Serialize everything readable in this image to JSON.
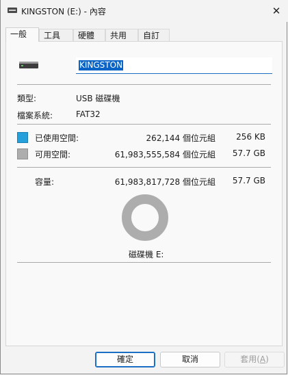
{
  "window": {
    "title": "KINGSTON (E:) - 內容",
    "close_glyph": "✕"
  },
  "tabs": [
    {
      "label": "一般",
      "active": true
    },
    {
      "label": "工具",
      "active": false
    },
    {
      "label": "硬體",
      "active": false
    },
    {
      "label": "共用",
      "active": false
    },
    {
      "label": "自訂",
      "active": false
    }
  ],
  "general": {
    "drive_icon": "usb-drive-icon",
    "volume_name": "KINGSTON",
    "type_label": "類型:",
    "type_value": "USB 磁碟機",
    "fs_label": "檔案系統:",
    "fs_value": "FAT32",
    "used": {
      "label": "已使用空間:",
      "bytes": "262,144 個位元組",
      "size": "256 KB",
      "color": "#26a0da"
    },
    "free": {
      "label": "可用空間:",
      "bytes": "61,983,555,584 個位元組",
      "size": "57.7 GB",
      "color": "#adadad"
    },
    "capacity": {
      "label": "容量:",
      "bytes": "61,983,817,728 個位元組",
      "size": "57.7 GB"
    },
    "used_fraction": 4.2e-06,
    "drive_label": "磁碟機 E:"
  },
  "buttons": {
    "ok": "確定",
    "cancel": "取消",
    "apply_prefix": "套用(",
    "apply_key": "A",
    "apply_suffix": ")"
  }
}
